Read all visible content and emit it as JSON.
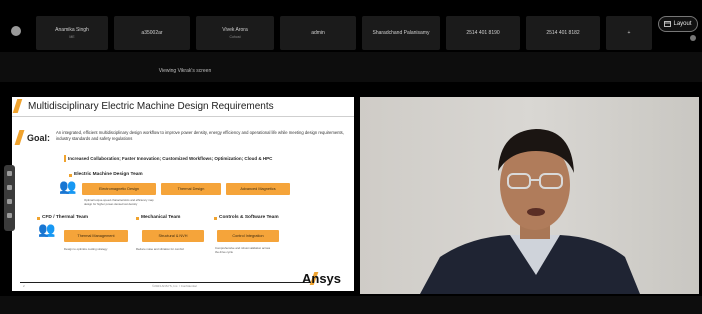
{
  "top_bar": {
    "participants": [
      {
        "name": "Anamika Singh",
        "sub": "ME"
      },
      {
        "name": "a35002ar",
        "sub": ""
      },
      {
        "name": "Vivek Arora",
        "sub": "Cohost"
      },
      {
        "name": "admin",
        "sub": ""
      },
      {
        "name": "Sharadchand Palanisamy",
        "sub": ""
      },
      {
        "name": "2514 401 8190",
        "sub": ""
      },
      {
        "name": "2514 401 8182",
        "sub": ""
      },
      {
        "name": "+",
        "sub": ""
      }
    ],
    "layout_button": "Layout",
    "layout_icon": "grid-layout-icon"
  },
  "viewing_text": "Viewing Vikrak's screen",
  "slide": {
    "title": "Multidisciplinary Electric Machine Design Requirements",
    "goal_label": "Goal:",
    "goal_text": "An integrated, efficient multidisciplinary design workflow to improve power density, energy efficiency and operational life while meeting design requirements, industry standards and safety regulations",
    "theme": "Increased Collaboration; Faster Innovation; Customized Workflows; Optimization; Cloud & HPC",
    "em_team": {
      "title": "Electric Machine Design Team",
      "chips": [
        "Electromagnetic Design",
        "Thermal Design",
        "Advanced Magnetics"
      ],
      "desc_line1": "Optimal torque-speed characteristics and efficiency map",
      "desc_line2": "design for higher power-dense/cost density"
    },
    "cfd_team": {
      "title": "CFD / Thermal Team",
      "chip": "Thermal Management",
      "desc": "Design to optimize cooling strategy"
    },
    "mech_team": {
      "title": "Mechanical Team",
      "chip": "Structural & NVH",
      "desc": "Reduce noise and vibration for comfort"
    },
    "controls_team": {
      "title": "Controls & Software Team",
      "chip": "Control Integration",
      "desc_line1": "Comprehensive and robust validation across",
      "desc_line2": "the drive cycle"
    },
    "page_number": "2",
    "footer_copy": "©2023 ANSYS, Inc. / Confidential",
    "brand": "Ansys"
  },
  "colors": {
    "accent": "#f0a32e",
    "chip": "#f5a43a",
    "background": "#0d0d0d"
  }
}
